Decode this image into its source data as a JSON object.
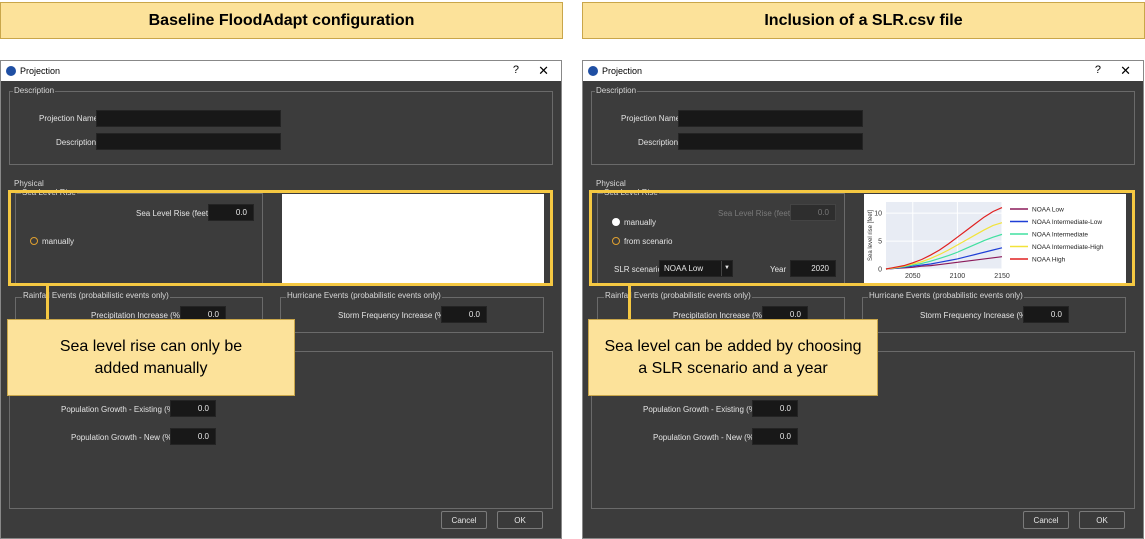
{
  "headers": {
    "left": "Baseline FloodAdapt configuration",
    "right": "Inclusion of a SLR.csv file"
  },
  "dialog": {
    "title": "Projection",
    "help": "?",
    "close": "✕",
    "description_group": "Description",
    "projection_name_label": "Projection Name",
    "description_label": "Description",
    "physical_group": "Physical",
    "slr_group": "Sea Level Rise",
    "slr_label": "Sea Level Rise (feet)",
    "slr_value": "0.0",
    "manually_label": "manually",
    "from_scenario_label": "from scenario",
    "slr_scenario_label": "SLR scenario",
    "slr_scenario_value": "NOAA Low",
    "year_label": "Year",
    "year_value": "2020",
    "rainfall_group": "Rainfall Events (probabilistic events only)",
    "precip_label": "Precipitation Increase (%)",
    "precip_value": "0.0",
    "hurricane_group": "Hurricane Events (probabilistic events only)",
    "storm_label": "Storm Frequency Increase (%)",
    "storm_value": "0.0",
    "pop_existing_label": "Population Growth - Existing (%)",
    "pop_existing_value": "0.0",
    "pop_new_label": "Population Growth - New (%)",
    "pop_new_value": "0.0",
    "cancel": "Cancel",
    "ok": "OK"
  },
  "callouts": {
    "left": "Sea level rise can only be added manually",
    "right": "Sea level can be added by choosing a SLR scenario and a year"
  },
  "chart_data": {
    "type": "line",
    "ylabel": "Sea level rise [feet]",
    "xlabel": "",
    "x": [
      2020,
      2030,
      2040,
      2050,
      2060,
      2070,
      2080,
      2090,
      2100,
      2110,
      2120,
      2130,
      2140,
      2150
    ],
    "xticks": [
      "2050",
      "2100",
      "2150"
    ],
    "yticks": [
      "0",
      "5",
      "10"
    ],
    "xlim": [
      2020,
      2150
    ],
    "ylim": [
      0,
      12
    ],
    "series": [
      {
        "name": "NOAA Low",
        "color": "#8b1a5a",
        "values": [
          0,
          0.1,
          0.2,
          0.3,
          0.5,
          0.6,
          0.8,
          1.0,
          1.2,
          1.4,
          1.6,
          1.8,
          2.0,
          2.2
        ]
      },
      {
        "name": "NOAA Intermediate-Low",
        "color": "#1f3fd6",
        "values": [
          0,
          0.1,
          0.3,
          0.5,
          0.7,
          0.9,
          1.2,
          1.5,
          1.8,
          2.2,
          2.6,
          3.0,
          3.4,
          3.8
        ]
      },
      {
        "name": "NOAA Intermediate",
        "color": "#40e0a0",
        "values": [
          0,
          0.2,
          0.4,
          0.7,
          1.0,
          1.4,
          1.9,
          2.4,
          3.0,
          3.7,
          4.4,
          5.1,
          5.7,
          6.2
        ]
      },
      {
        "name": "NOAA Intermediate-High",
        "color": "#f2e33a",
        "values": [
          0,
          0.2,
          0.5,
          0.9,
          1.3,
          1.9,
          2.6,
          3.4,
          4.3,
          5.2,
          6.1,
          7.0,
          7.8,
          8.3
        ]
      },
      {
        "name": "NOAA High",
        "color": "#e02020",
        "values": [
          0,
          0.3,
          0.6,
          1.1,
          1.7,
          2.5,
          3.4,
          4.5,
          5.7,
          6.9,
          8.1,
          9.3,
          10.3,
          11.0
        ]
      }
    ],
    "legend_position": "right",
    "grid": true
  }
}
